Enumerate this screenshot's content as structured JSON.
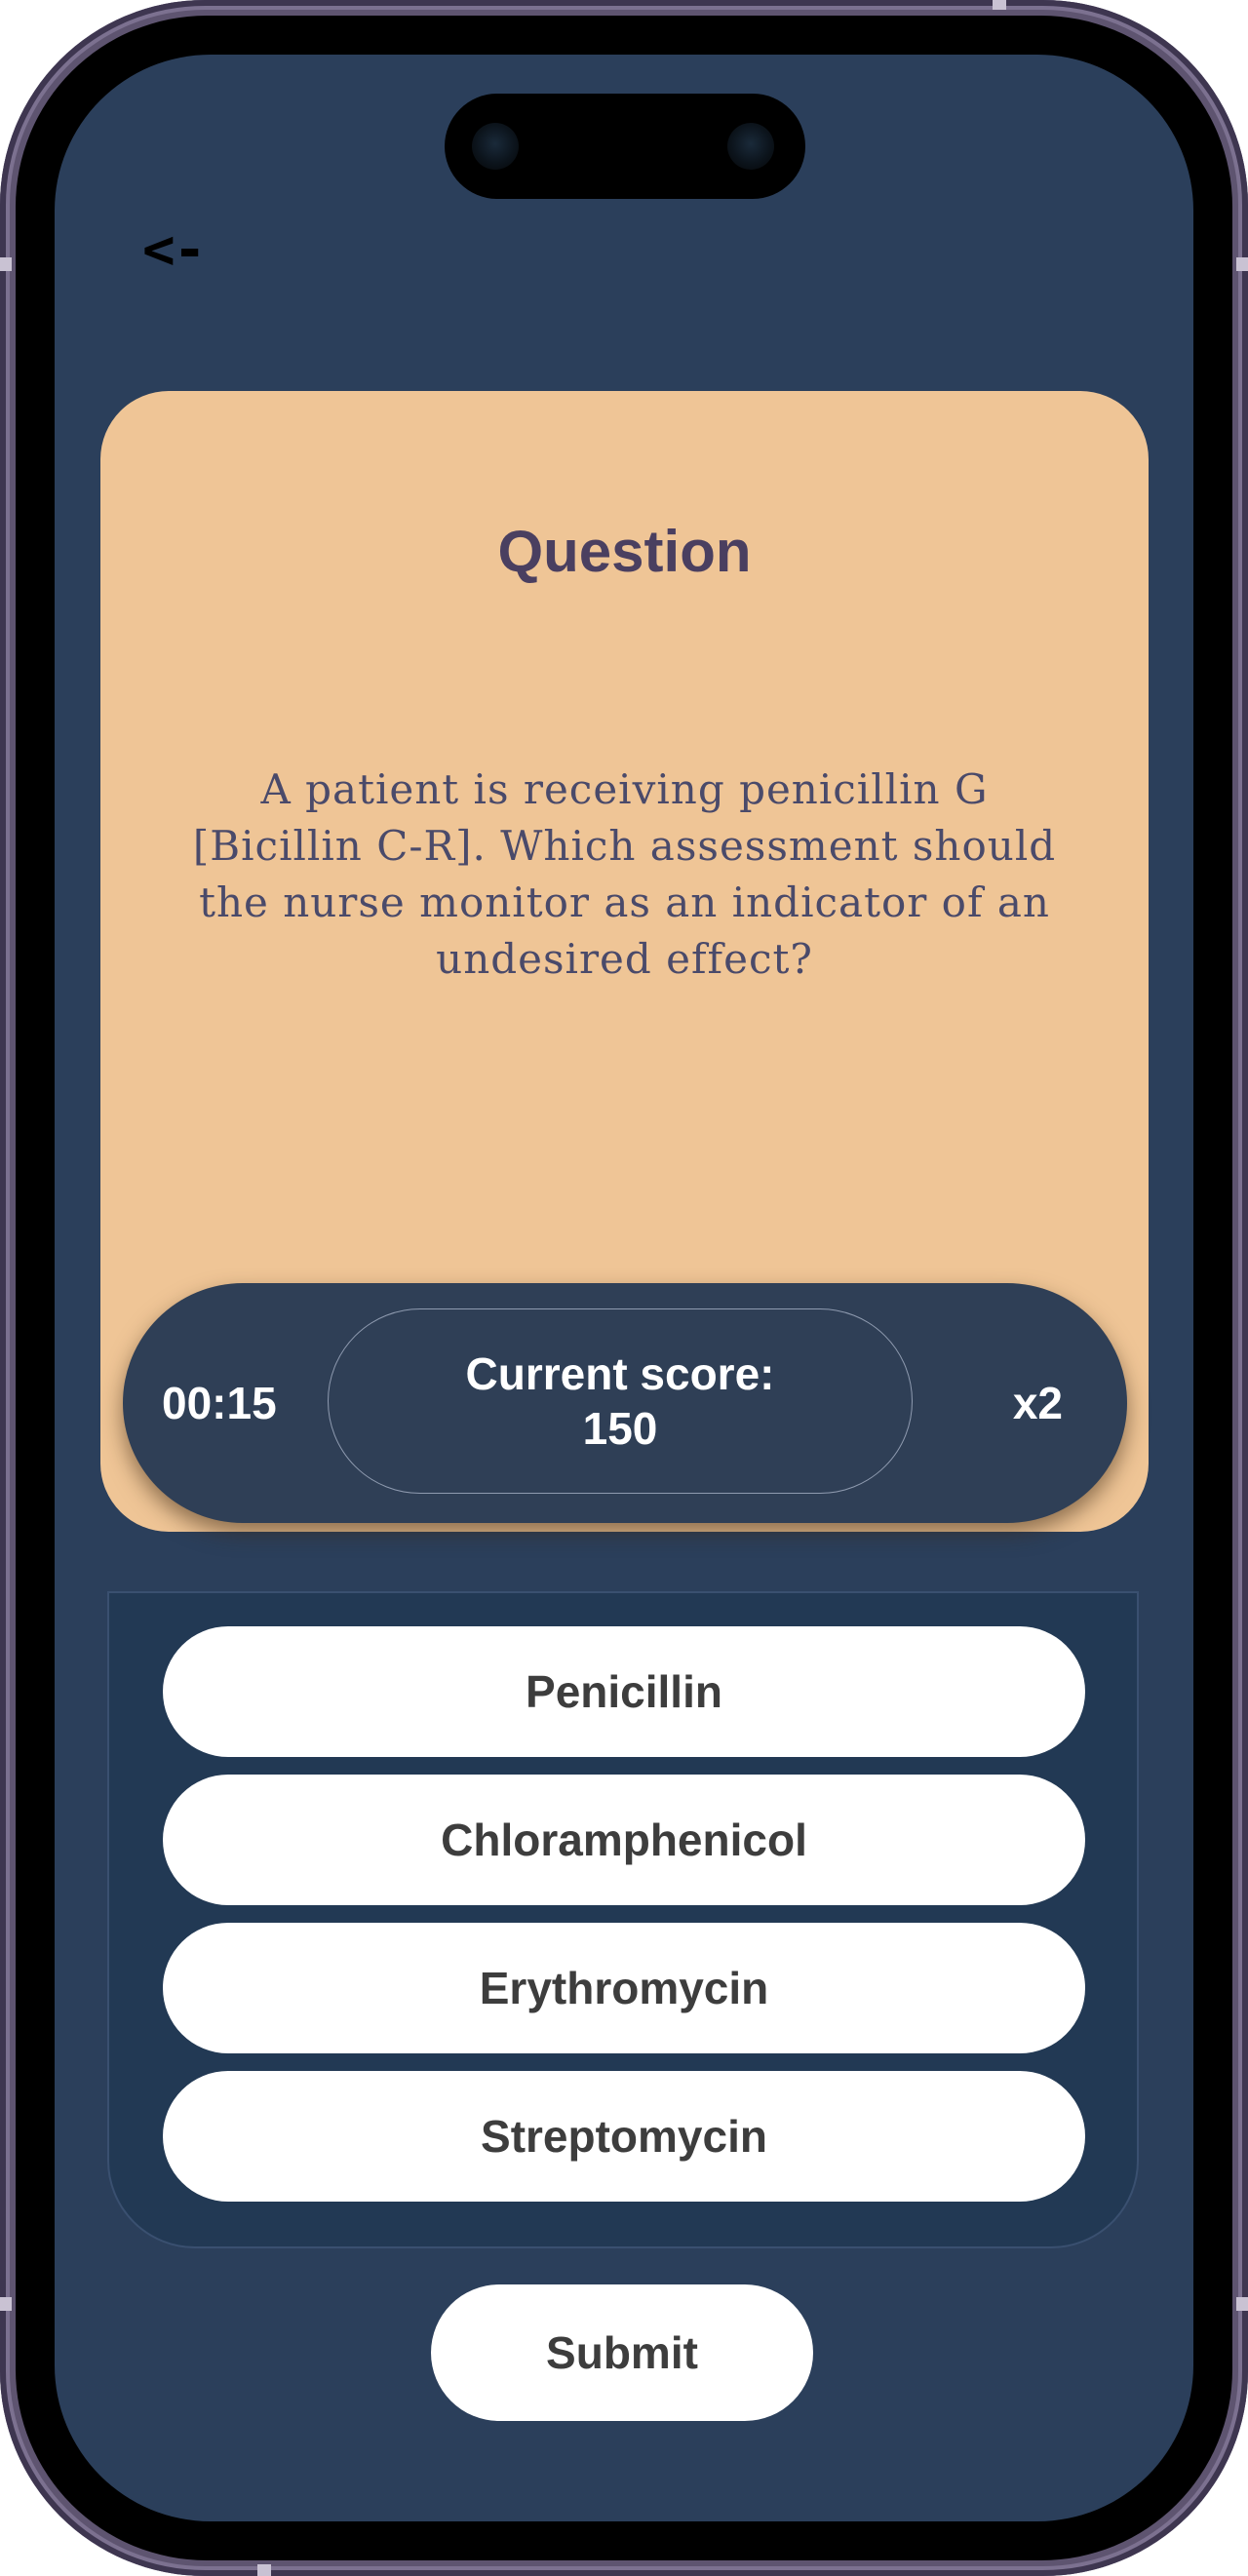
{
  "nav": {
    "back_label": "<-"
  },
  "question": {
    "title": "Question",
    "text": "A patient is receiving penicillin G [Bicillin C-R]. Which assessment should the nurse monitor as an indicator of an undesired effect?"
  },
  "status": {
    "timer": "00:15",
    "score_label": "Current score:",
    "score_value": "150",
    "multiplier": "x2"
  },
  "answers": [
    {
      "label": "Penicillin"
    },
    {
      "label": "Chloramphenicol"
    },
    {
      "label": "Erythromycin"
    },
    {
      "label": "Streptomycin"
    }
  ],
  "submit_label": "Submit",
  "colors": {
    "screen_bg": "#2b3f5b",
    "card_bg": "#efc596",
    "status_bar_bg": "#2f3f56",
    "answers_panel_bg": "#223954",
    "button_bg": "#ffffff",
    "title_color": "#4a3f60"
  }
}
